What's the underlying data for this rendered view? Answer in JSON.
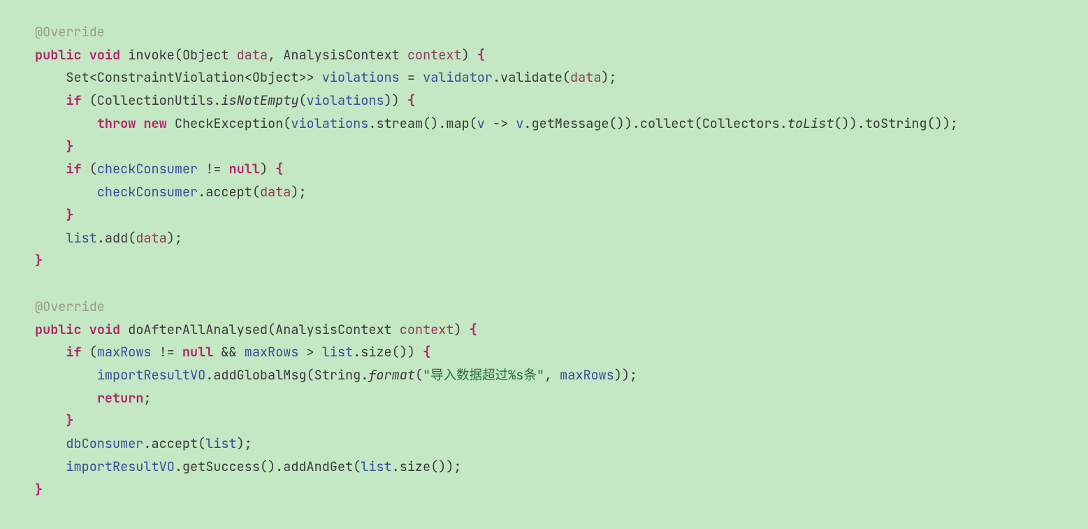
{
  "code": {
    "lines": [
      {
        "indent": 0,
        "segs": [
          {
            "cls": "annot",
            "t": "@Override"
          }
        ]
      },
      {
        "indent": 0,
        "segs": [
          {
            "cls": "kw-b",
            "t": "public"
          },
          {
            "t": " "
          },
          {
            "cls": "kw-b",
            "t": "void"
          },
          {
            "t": " "
          },
          {
            "cls": "fn",
            "t": "invoke"
          },
          {
            "t": "("
          },
          {
            "cls": "type",
            "t": "Object "
          },
          {
            "cls": "param",
            "t": "data"
          },
          {
            "t": ", "
          },
          {
            "cls": "type",
            "t": "AnalysisContext "
          },
          {
            "cls": "param",
            "t": "context"
          },
          {
            "t": ") "
          },
          {
            "cls": "brace",
            "t": "{"
          }
        ]
      },
      {
        "indent": 1,
        "segs": [
          {
            "cls": "type",
            "t": "Set"
          },
          {
            "t": "<"
          },
          {
            "cls": "type",
            "t": "ConstraintViolation"
          },
          {
            "t": "<"
          },
          {
            "cls": "type",
            "t": "Object"
          },
          {
            "t": ">> "
          },
          {
            "cls": "var",
            "t": "violations"
          },
          {
            "t": " = "
          },
          {
            "cls": "var",
            "t": "validator"
          },
          {
            "t": ".validate("
          },
          {
            "cls": "param",
            "t": "data"
          },
          {
            "t": ");"
          }
        ]
      },
      {
        "indent": 1,
        "segs": [
          {
            "cls": "kw-b",
            "t": "if"
          },
          {
            "t": " (CollectionUtils."
          },
          {
            "cls": "ital",
            "t": "isNotEmpty"
          },
          {
            "t": "("
          },
          {
            "cls": "var",
            "t": "violations"
          },
          {
            "t": ")) "
          },
          {
            "cls": "brace",
            "t": "{"
          }
        ]
      },
      {
        "indent": 2,
        "segs": [
          {
            "cls": "kw-b",
            "t": "throw"
          },
          {
            "t": " "
          },
          {
            "cls": "kw-b",
            "t": "new"
          },
          {
            "t": " CheckException("
          },
          {
            "cls": "var",
            "t": "violations"
          },
          {
            "t": ".stream().map("
          },
          {
            "cls": "var",
            "t": "v"
          },
          {
            "t": " -> "
          },
          {
            "cls": "var",
            "t": "v"
          },
          {
            "t": ".getMessage()).collect(Collectors."
          },
          {
            "cls": "ital",
            "t": "toList"
          },
          {
            "t": "()).toString());"
          }
        ]
      },
      {
        "indent": 1,
        "segs": [
          {
            "cls": "brace",
            "t": "}"
          }
        ]
      },
      {
        "indent": 1,
        "segs": [
          {
            "cls": "kw-b",
            "t": "if"
          },
          {
            "t": " ("
          },
          {
            "cls": "var",
            "t": "checkConsumer"
          },
          {
            "t": " != "
          },
          {
            "cls": "kw-b",
            "t": "null"
          },
          {
            "t": ") "
          },
          {
            "cls": "brace",
            "t": "{"
          }
        ]
      },
      {
        "indent": 2,
        "segs": [
          {
            "cls": "var",
            "t": "checkConsumer"
          },
          {
            "t": ".accept("
          },
          {
            "cls": "param",
            "t": "data"
          },
          {
            "t": ");"
          }
        ]
      },
      {
        "indent": 1,
        "segs": [
          {
            "cls": "brace",
            "t": "}"
          }
        ]
      },
      {
        "indent": 1,
        "segs": [
          {
            "cls": "var",
            "t": "list"
          },
          {
            "t": ".add("
          },
          {
            "cls": "param",
            "t": "data"
          },
          {
            "t": ");"
          }
        ]
      },
      {
        "indent": 0,
        "segs": [
          {
            "cls": "brace",
            "t": "}"
          }
        ]
      },
      {
        "indent": 0,
        "segs": [
          {
            "t": ""
          }
        ]
      },
      {
        "indent": 0,
        "segs": [
          {
            "cls": "annot",
            "t": "@Override"
          }
        ]
      },
      {
        "indent": 0,
        "segs": [
          {
            "cls": "kw-b",
            "t": "public"
          },
          {
            "t": " "
          },
          {
            "cls": "kw-b",
            "t": "void"
          },
          {
            "t": " "
          },
          {
            "cls": "fn",
            "t": "doAfterAllAnalysed"
          },
          {
            "t": "("
          },
          {
            "cls": "type",
            "t": "AnalysisContext "
          },
          {
            "cls": "param",
            "t": "context"
          },
          {
            "t": ") "
          },
          {
            "cls": "brace",
            "t": "{"
          }
        ]
      },
      {
        "indent": 1,
        "segs": [
          {
            "cls": "kw-b",
            "t": "if"
          },
          {
            "t": " ("
          },
          {
            "cls": "var",
            "t": "maxRows"
          },
          {
            "t": " != "
          },
          {
            "cls": "kw-b",
            "t": "null"
          },
          {
            "t": " && "
          },
          {
            "cls": "var",
            "t": "maxRows"
          },
          {
            "t": " > "
          },
          {
            "cls": "var",
            "t": "list"
          },
          {
            "t": ".size()) "
          },
          {
            "cls": "brace",
            "t": "{"
          }
        ]
      },
      {
        "indent": 2,
        "segs": [
          {
            "cls": "var",
            "t": "importResultVO"
          },
          {
            "t": ".addGlobalMsg(String."
          },
          {
            "cls": "ital",
            "t": "format"
          },
          {
            "t": "("
          },
          {
            "cls": "str",
            "t": "\"导入数据超过%s条\""
          },
          {
            "t": ", "
          },
          {
            "cls": "var",
            "t": "maxRows"
          },
          {
            "t": "));"
          }
        ]
      },
      {
        "indent": 2,
        "segs": [
          {
            "cls": "kw-b",
            "t": "return"
          },
          {
            "t": ";"
          }
        ]
      },
      {
        "indent": 1,
        "segs": [
          {
            "cls": "brace",
            "t": "}"
          }
        ]
      },
      {
        "indent": 1,
        "segs": [
          {
            "cls": "var",
            "t": "dbConsumer"
          },
          {
            "t": ".accept("
          },
          {
            "cls": "var",
            "t": "list"
          },
          {
            "t": ");"
          }
        ]
      },
      {
        "indent": 1,
        "segs": [
          {
            "cls": "var",
            "t": "importResultVO"
          },
          {
            "t": ".getSuccess().addAndGet("
          },
          {
            "cls": "var",
            "t": "list"
          },
          {
            "t": ".size());"
          }
        ]
      },
      {
        "indent": 0,
        "segs": [
          {
            "cls": "brace",
            "t": "}"
          }
        ]
      }
    ]
  }
}
